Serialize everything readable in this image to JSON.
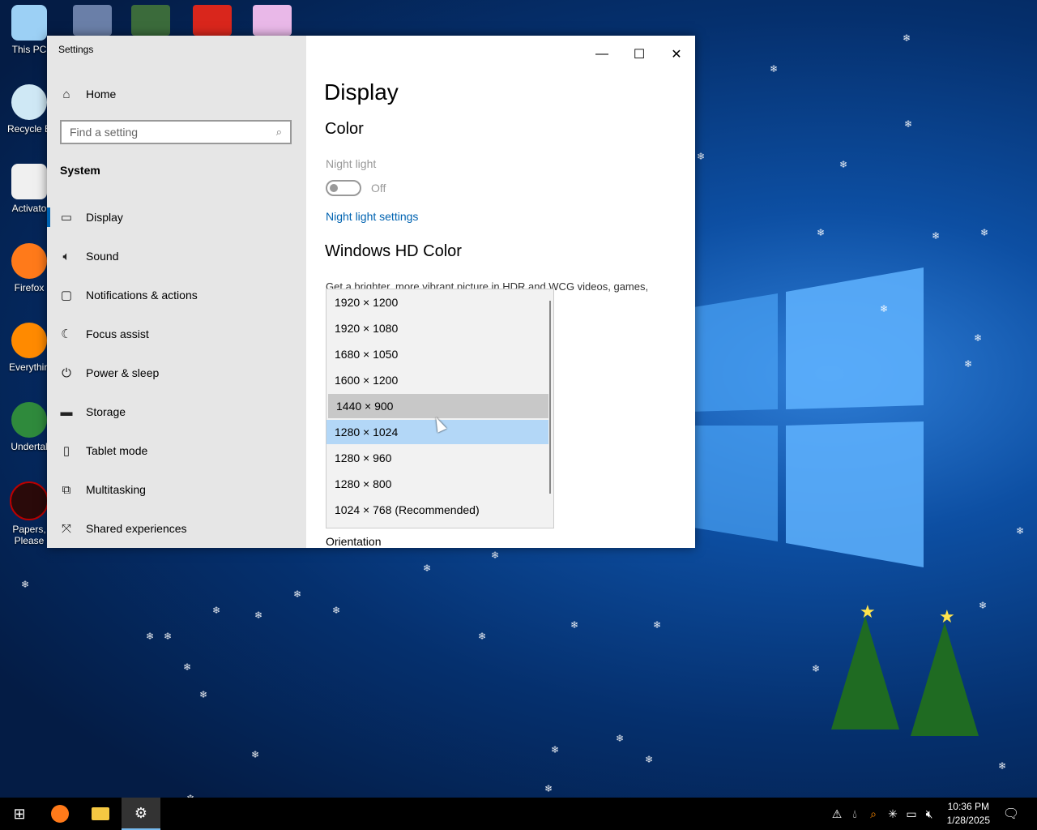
{
  "desktop": {
    "icons": [
      {
        "label": "This PC",
        "icon": "computer-icon"
      },
      {
        "label": "Recycle B",
        "icon": "recycle-bin-icon"
      },
      {
        "label": "Activato",
        "icon": "file-icon"
      },
      {
        "label": "Firefox",
        "icon": "firefox-icon"
      },
      {
        "label": "Everythin",
        "icon": "search-icon"
      },
      {
        "label": "Undertal",
        "icon": "game-icon"
      },
      {
        "label": "Papers, Please",
        "icon": "game-icon"
      }
    ]
  },
  "window": {
    "title": "Settings",
    "controls": {
      "minimize": "—",
      "maximize": "☐",
      "close": "✕"
    }
  },
  "sidebar": {
    "home": "Home",
    "search_placeholder": "Find a setting",
    "section": "System",
    "items": [
      {
        "label": "Display",
        "icon": "monitor-icon"
      },
      {
        "label": "Sound",
        "icon": "speaker-icon"
      },
      {
        "label": "Notifications & actions",
        "icon": "notification-icon"
      },
      {
        "label": "Focus assist",
        "icon": "moon-icon"
      },
      {
        "label": "Power & sleep",
        "icon": "power-icon"
      },
      {
        "label": "Storage",
        "icon": "storage-icon"
      },
      {
        "label": "Tablet mode",
        "icon": "tablet-icon"
      },
      {
        "label": "Multitasking",
        "icon": "multitasking-icon"
      },
      {
        "label": "Shared experiences",
        "icon": "shared-icon"
      }
    ]
  },
  "main": {
    "title": "Display",
    "color_heading": "Color",
    "night_light_label": "Night light",
    "night_light_state": "Off",
    "night_light_link": "Night light settings",
    "hd_heading": "Windows HD Color",
    "hd_desc": "Get a brighter, more vibrant picture in HDR and WCG videos, games,",
    "orientation_label": "Orientation"
  },
  "resolution_dropdown": {
    "options": [
      "1920 × 1200",
      "1920 × 1080",
      "1680 × 1050",
      "1600 × 1200",
      "1440 × 900",
      "1280 × 1024",
      "1280 × 960",
      "1280 × 800",
      "1024 × 768 (Recommended)"
    ],
    "hovered": "1440 × 900",
    "selected": "1280 × 1024"
  },
  "taskbar": {
    "time": "10:36 PM",
    "date": "1/28/2025"
  }
}
